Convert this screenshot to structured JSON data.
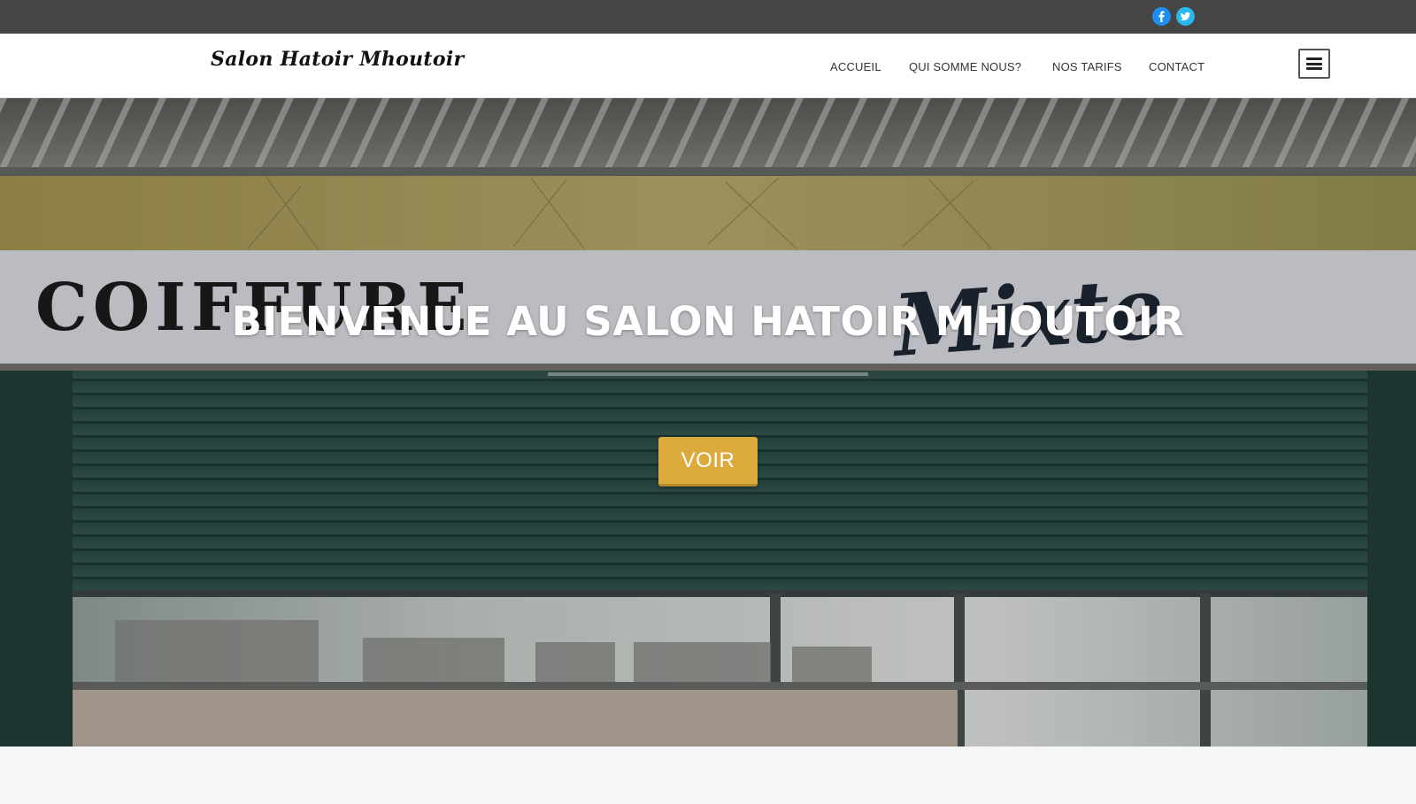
{
  "topbar": {
    "social": [
      {
        "icon": "facebook-icon",
        "color": "#1e8ff0"
      },
      {
        "icon": "twitter-icon",
        "color": "#27b8ee"
      }
    ]
  },
  "header": {
    "logo_text": "Salon Hatoir Mhoutoir",
    "nav": {
      "items": [
        {
          "label": "ACCUEIL"
        },
        {
          "label": "QUI SOMME NOUS?"
        },
        {
          "label": "NOS TARIFS"
        },
        {
          "label": "CONTACT"
        }
      ]
    },
    "menu_icon": "hamburger-menu-icon"
  },
  "hero": {
    "title": "BIENVENUE AU SALON HATOIR MHOUTOIR",
    "button_label": "VOIR",
    "button_color": "#ddaa3d",
    "background_sign_text": "COIFFURE Mixte"
  }
}
